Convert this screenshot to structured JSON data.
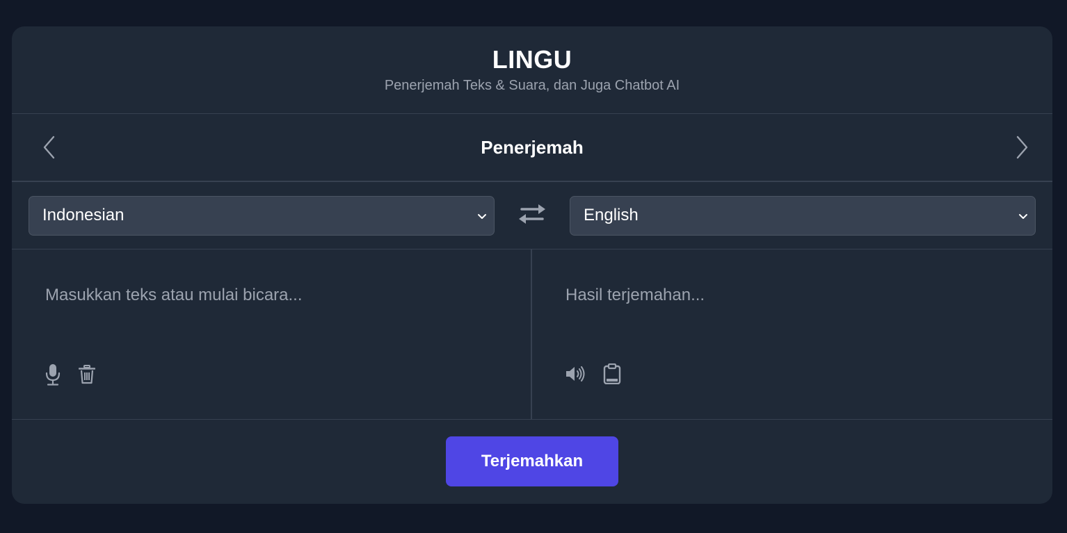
{
  "app": {
    "title": "LINGU",
    "subtitle": "Penerjemah Teks & Suara, dan Juga Chatbot AI"
  },
  "nav": {
    "title": "Penerjemah",
    "prev_icon": "chevron-left-icon",
    "next_icon": "chevron-right-icon"
  },
  "languages": {
    "source": "Indonesian",
    "target": "English",
    "swap_icon": "swap-arrows-icon"
  },
  "input_panel": {
    "placeholder": "Masukkan teks atau mulai bicara...",
    "icons": [
      "microphone-icon",
      "trash-icon"
    ]
  },
  "output_panel": {
    "placeholder": "Hasil terjemahan...",
    "icons": [
      "speaker-icon",
      "clipboard-icon"
    ]
  },
  "actions": {
    "translate_label": "Terjemahkan"
  },
  "colors": {
    "background": "#111827",
    "card": "#1f2937",
    "select": "#374151",
    "accent": "#4f46e5",
    "muted_text": "#9ca3af"
  }
}
